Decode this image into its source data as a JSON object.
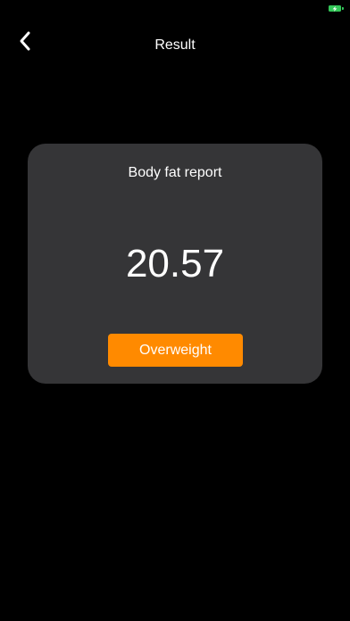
{
  "status_bar": {
    "battery_icon": "battery-charging-icon",
    "battery_color": "#34c759"
  },
  "nav": {
    "back_icon": "chevron-left-icon",
    "title": "Result"
  },
  "card": {
    "title": "Body fat report",
    "value": "20.57",
    "status_label": "Overweight",
    "status_color": "#ff8a00",
    "background": "#353537"
  }
}
